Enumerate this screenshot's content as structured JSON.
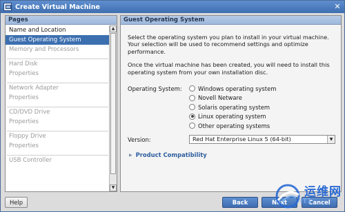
{
  "window": {
    "title": "Create Virtual Machine"
  },
  "pages": {
    "header": "Pages",
    "items": [
      {
        "label": "Name and Location",
        "state": "normal"
      },
      {
        "label": "Guest Operating System",
        "state": "selected"
      },
      {
        "label": "Memory and Processors",
        "state": "disabled"
      },
      {
        "label": "Hard Disk",
        "state": "disabled"
      },
      {
        "label": "Properties",
        "state": "disabled"
      },
      {
        "label": "Network Adapter",
        "state": "disabled"
      },
      {
        "label": "Properties",
        "state": "disabled"
      },
      {
        "label": "CD/DVD Drive",
        "state": "disabled"
      },
      {
        "label": "Properties",
        "state": "disabled"
      },
      {
        "label": "Floppy Drive",
        "state": "disabled"
      },
      {
        "label": "Properties",
        "state": "disabled"
      },
      {
        "label": "USB Controller",
        "state": "disabled"
      }
    ]
  },
  "content": {
    "header": "Guest Operating System",
    "description1": "Select the operating system you plan to install in your virtual machine. Your selection will be used to recommend settings and optimize performance.",
    "description2": "Once the virtual machine has been created, you will need to install this operating system from your own installation disc.",
    "os_label": "Operating System:",
    "os_options": [
      {
        "label": "Windows operating system",
        "checked": false
      },
      {
        "label": "Novell Netware",
        "checked": false
      },
      {
        "label": "Solaris operating system",
        "checked": false
      },
      {
        "label": "Linux operating system",
        "checked": true
      },
      {
        "label": "Other operating systems",
        "checked": false
      }
    ],
    "version_label": "Version:",
    "version_value": "Red Hat Enterprise Linux 5 (64-bit)",
    "expander_label": "Product Compatibility"
  },
  "buttons": {
    "help": "Help",
    "back": "Back",
    "next": "Next",
    "cancel": "Cancel"
  },
  "watermark": {
    "text": "运维网",
    "sub": "IT1"
  },
  "colors": {
    "titlebar": "#4a7cc0",
    "selection": "#3c6fb0",
    "button": "#4a7cc0",
    "link": "#2f5f9f"
  }
}
